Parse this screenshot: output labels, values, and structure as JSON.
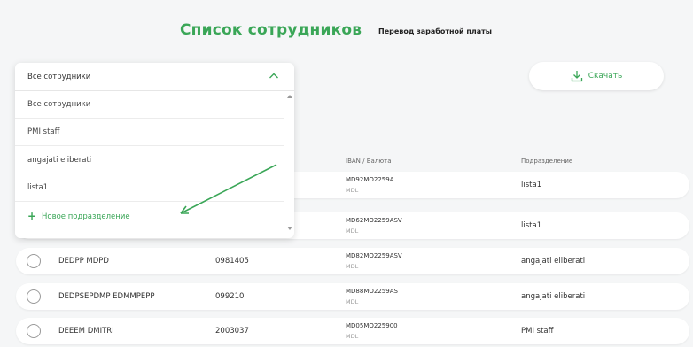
{
  "header": {
    "title": "Список сотрудников",
    "tab_salary": "Перевод заработной платы"
  },
  "download": {
    "label": "Скачать",
    "icon": "download-icon"
  },
  "columns": {
    "iban": "IBAN / Валюта",
    "department": "Подразделение"
  },
  "dropdown": {
    "selected": "Все сотрудники",
    "options": [
      "Все сотрудники",
      "PMI staff",
      "angajati eliberati",
      "lista1"
    ],
    "add_label": "Новое подразделение",
    "expanded": true
  },
  "rows": [
    {
      "name": "",
      "phone": "",
      "iban": "MD92MO2259A",
      "currency": "MDL",
      "department": "lista1"
    },
    {
      "name": "",
      "phone": "",
      "iban": "MD62MO2259ASV",
      "currency": "MDL",
      "department": "lista1"
    },
    {
      "name": "DEDPP MDPD",
      "phone": "0981405",
      "iban": "MD82MO2259ASV",
      "currency": "MDL",
      "department": "angajati eliberati"
    },
    {
      "name": "DEDPSEPDMP EDMMPEPP",
      "phone": "099210",
      "iban": "MD88MO2259AS",
      "currency": "MDL",
      "department": "angajati eliberati"
    },
    {
      "name": "DEEEM DMITRI",
      "phone": "2003037",
      "iban": "MD05MO225900",
      "currency": "MDL",
      "department": "PMI staff"
    }
  ],
  "colors": {
    "accent": "#3aa657",
    "background": "#f5f6f7",
    "annotation_arrow": "#3aa657"
  }
}
